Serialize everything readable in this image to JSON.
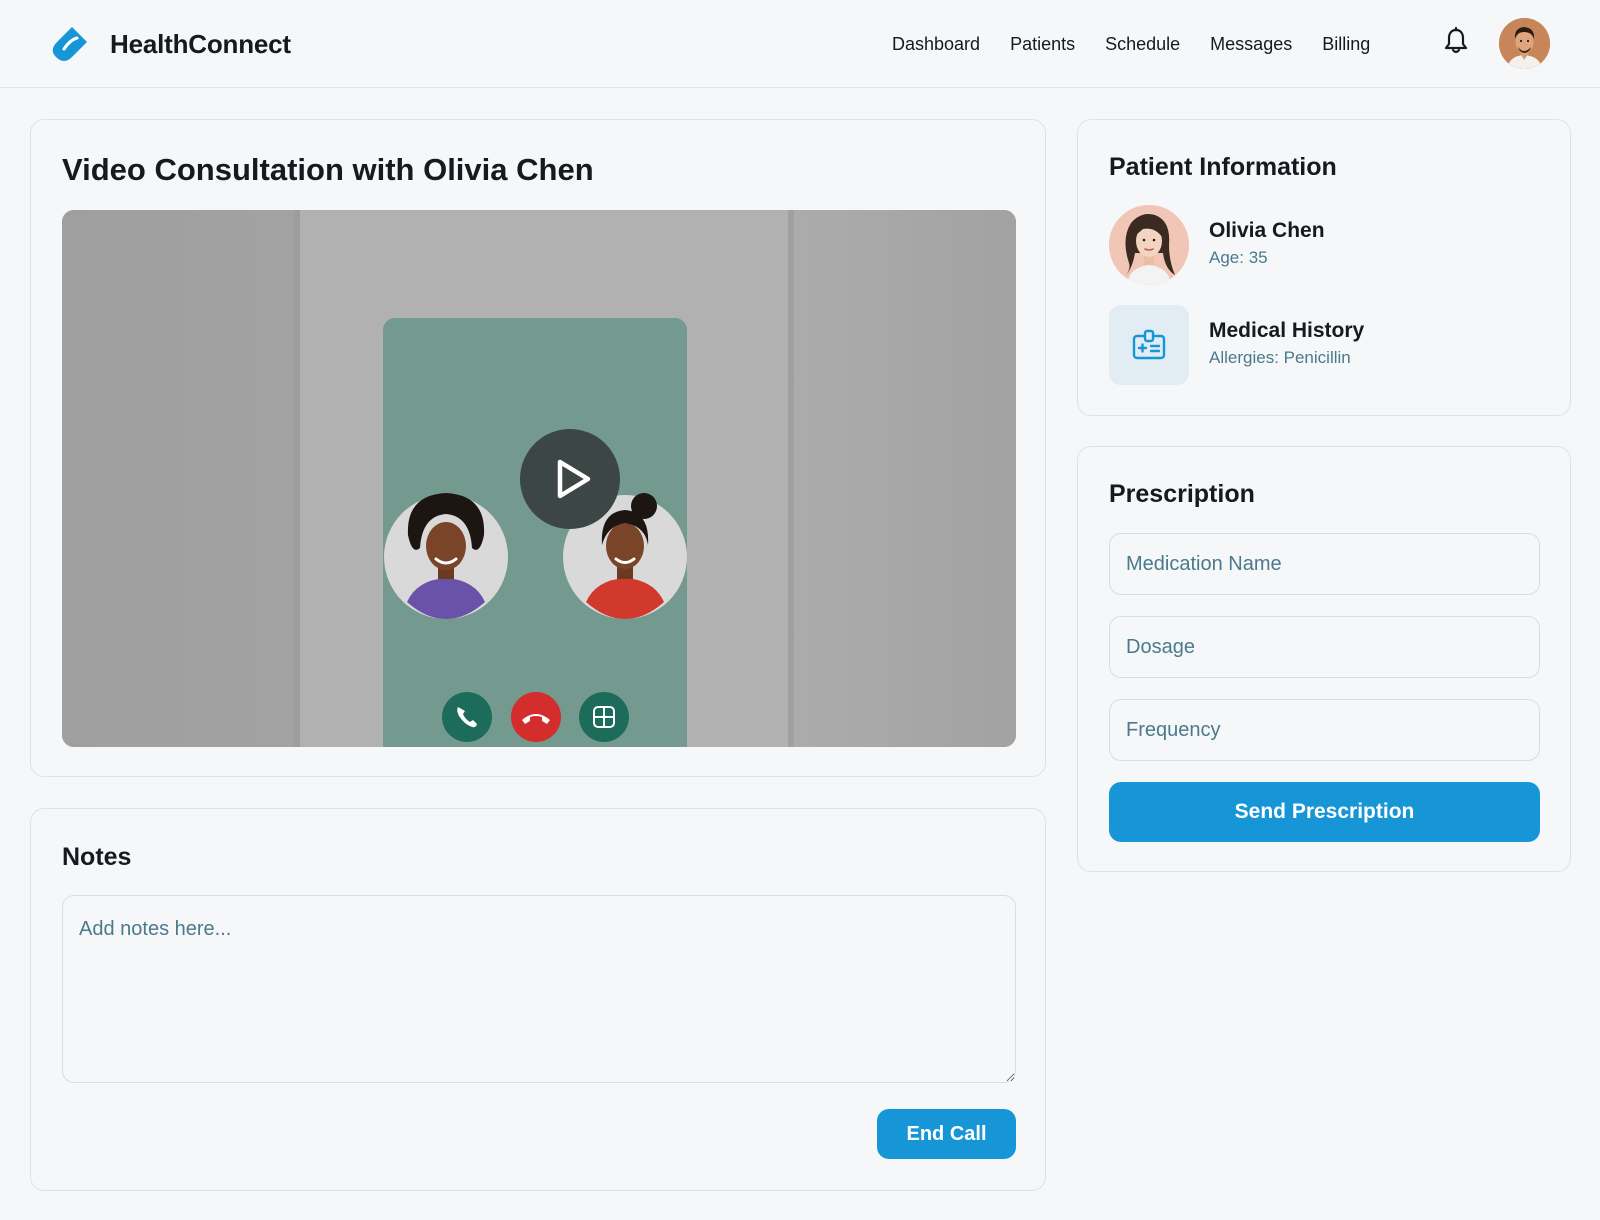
{
  "app": {
    "name": "HealthConnect",
    "logo_icon": "pill-drop-icon",
    "accent_color": "#1796d7"
  },
  "nav": {
    "items": [
      {
        "label": "Dashboard"
      },
      {
        "label": "Patients"
      },
      {
        "label": "Schedule"
      },
      {
        "label": "Messages"
      },
      {
        "label": "Billing"
      }
    ],
    "notification_icon": "bell-icon",
    "user_avatar": "doctor-avatar"
  },
  "video": {
    "title": "Video Consultation with Olivia Chen",
    "play_icon": "play-icon",
    "call_controls": [
      "phone-icon",
      "hang-up-icon",
      "gallery-icon"
    ]
  },
  "notes": {
    "title": "Notes",
    "placeholder": "Add notes here...",
    "end_call_label": "End Call"
  },
  "patient": {
    "title": "Patient Information",
    "name": "Olivia Chen",
    "age": "Age: 35",
    "history_title": "Medical History",
    "history_detail": "Allergies: Penicillin",
    "history_icon": "medical-id-icon"
  },
  "prescription": {
    "title": "Prescription",
    "medication_placeholder": "Medication Name",
    "dosage_placeholder": "Dosage",
    "frequency_placeholder": "Frequency",
    "send_label": "Send Prescription"
  }
}
